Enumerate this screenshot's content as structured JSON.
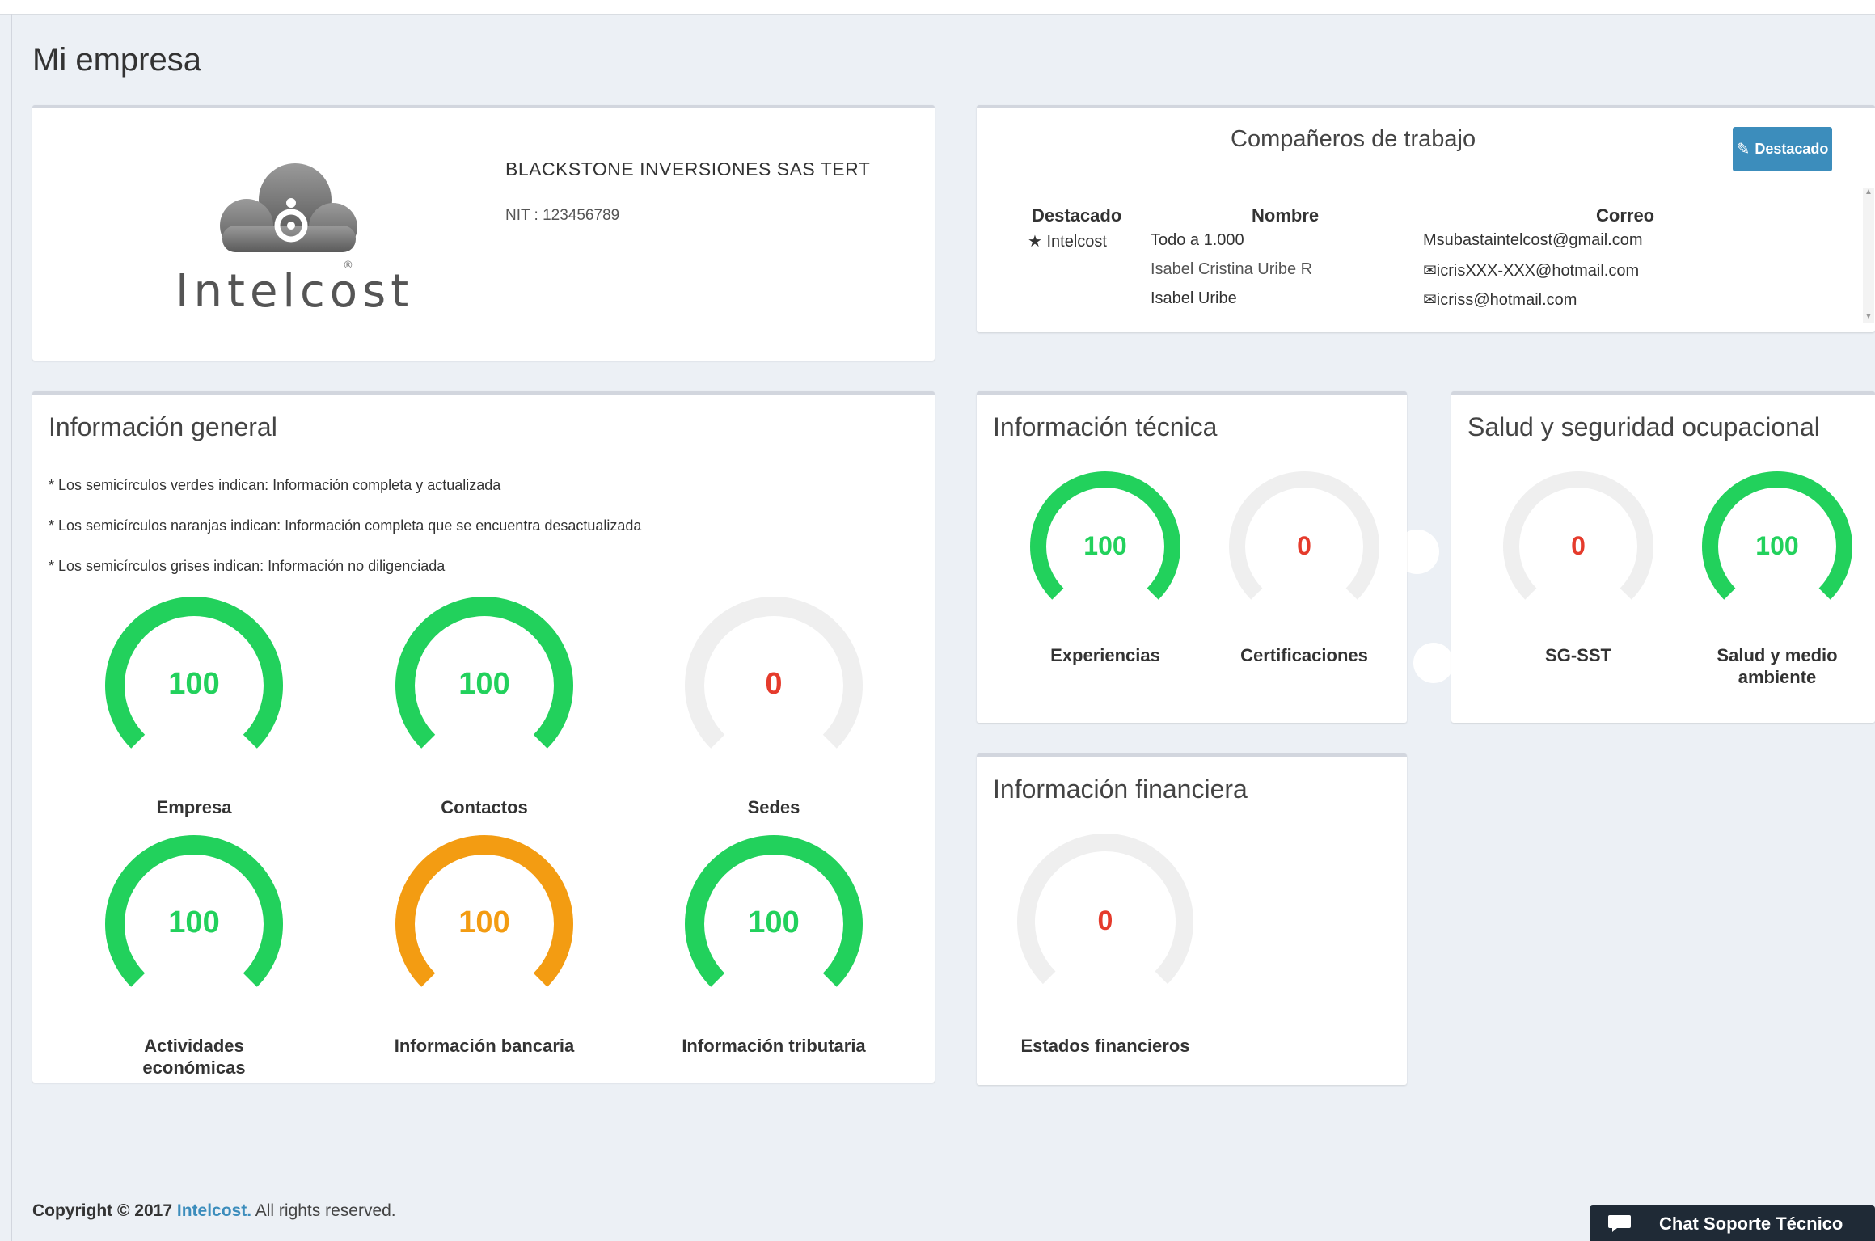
{
  "page": {
    "title": "Mi empresa"
  },
  "company": {
    "logo_text": "Intelcost",
    "name": "BLACKSTONE INVERSIONES SAS TERT",
    "nit": "NIT : 123456789"
  },
  "coworkers": {
    "title": "Compañeros de trabajo",
    "button_label": "Destacado",
    "columns": [
      "Destacado",
      "Nombre",
      "Correo"
    ],
    "rows": [
      {
        "destacado": "★ Intelcost",
        "nombre": "Todo a 1.000",
        "correo": "Msubastaintelcost@gmail.com"
      },
      {
        "destacado": "",
        "nombre": "Isabel Cristina Uribe R",
        "correo": "icrisXXX-XXX@hotmail.com"
      },
      {
        "destacado": "",
        "nombre": "Isabel Uribe",
        "correo": "icriss@hotmail.com"
      }
    ]
  },
  "general": {
    "title": "Información general",
    "notes": [
      "* Los semicírculos verdes indican: Información completa y actualizada",
      "* Los semicírculos naranjas indican: Información completa que se encuentra desactualizada",
      "* Los semicírculos grises indican: Información no diligenciada"
    ],
    "gauges": [
      {
        "value": "100",
        "label": "Empresa",
        "status": "green"
      },
      {
        "value": "100",
        "label": "Contactos",
        "status": "green"
      },
      {
        "value": "0",
        "label": "Sedes",
        "status": "gray"
      },
      {
        "value": "100",
        "label": "Actividades económicas",
        "status": "green"
      },
      {
        "value": "100",
        "label": "Información bancaria",
        "status": "orange"
      },
      {
        "value": "100",
        "label": "Información tributaria",
        "status": "green"
      }
    ]
  },
  "tecnica": {
    "title": "Información técnica",
    "gauges": [
      {
        "value": "100",
        "label": "Experiencias",
        "status": "green"
      },
      {
        "value": "0",
        "label": "Certificaciones",
        "status": "gray"
      }
    ]
  },
  "salud": {
    "title": "Salud y seguridad ocupacional",
    "gauges": [
      {
        "value": "0",
        "label": "SG-SST",
        "status": "gray"
      },
      {
        "value": "100",
        "label": "Salud y medio ambiente",
        "status": "green"
      }
    ]
  },
  "financiera": {
    "title": "Información financiera",
    "gauges": [
      {
        "value": "0",
        "label": "Estados financieros",
        "status": "gray"
      }
    ]
  },
  "footer": {
    "prefix": "Copyright © 2017",
    "brand": "Intelcost.",
    "suffix": "All rights reserved."
  },
  "chat": {
    "label": "Chat Soporte Técnico"
  },
  "colors": {
    "green": "#22d15c",
    "orange": "#f39c12",
    "gray": "#efefef",
    "zero_text": "#e53b2c",
    "accent": "#3c8dbc"
  }
}
